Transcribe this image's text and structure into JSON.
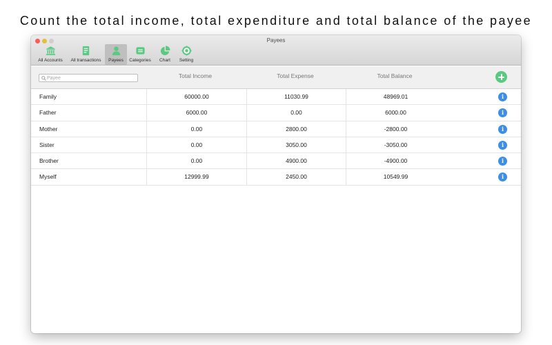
{
  "caption": "Count the total income, total expenditure and total balance of the payee",
  "window": {
    "title": "Payees"
  },
  "toolbar": {
    "items": [
      {
        "label": "All Accounts",
        "icon": "bank-icon"
      },
      {
        "label": "All transactions",
        "icon": "document-icon"
      },
      {
        "label": "Payees",
        "icon": "person-icon",
        "active": true
      },
      {
        "label": "Categories",
        "icon": "category-icon"
      },
      {
        "label": "Chart",
        "icon": "pie-chart-icon"
      },
      {
        "label": "Setting",
        "icon": "gear-icon"
      }
    ]
  },
  "search": {
    "placeholder": "Payee",
    "value": ""
  },
  "columns": {
    "income": "Total Income",
    "expense": "Total Expense",
    "balance": "Total Balance"
  },
  "payees": [
    {
      "name": "Family",
      "income": "60000.00",
      "expense": "11030.99",
      "balance": "48969.01"
    },
    {
      "name": "Father",
      "income": "6000.00",
      "expense": "0.00",
      "balance": "6000.00"
    },
    {
      "name": "Mother",
      "income": "0.00",
      "expense": "2800.00",
      "balance": "-2800.00"
    },
    {
      "name": "Sister",
      "income": "0.00",
      "expense": "3050.00",
      "balance": "-3050.00"
    },
    {
      "name": "Brother",
      "income": "0.00",
      "expense": "4900.00",
      "balance": "-4900.00"
    },
    {
      "name": "Myself",
      "income": "12999.99",
      "expense": "2450.00",
      "balance": "10549.99"
    }
  ],
  "colors": {
    "accent_green": "#5bc982",
    "info_blue": "#3d8fe6",
    "close": "#fc5b57",
    "minimize": "#e5bf3c"
  }
}
